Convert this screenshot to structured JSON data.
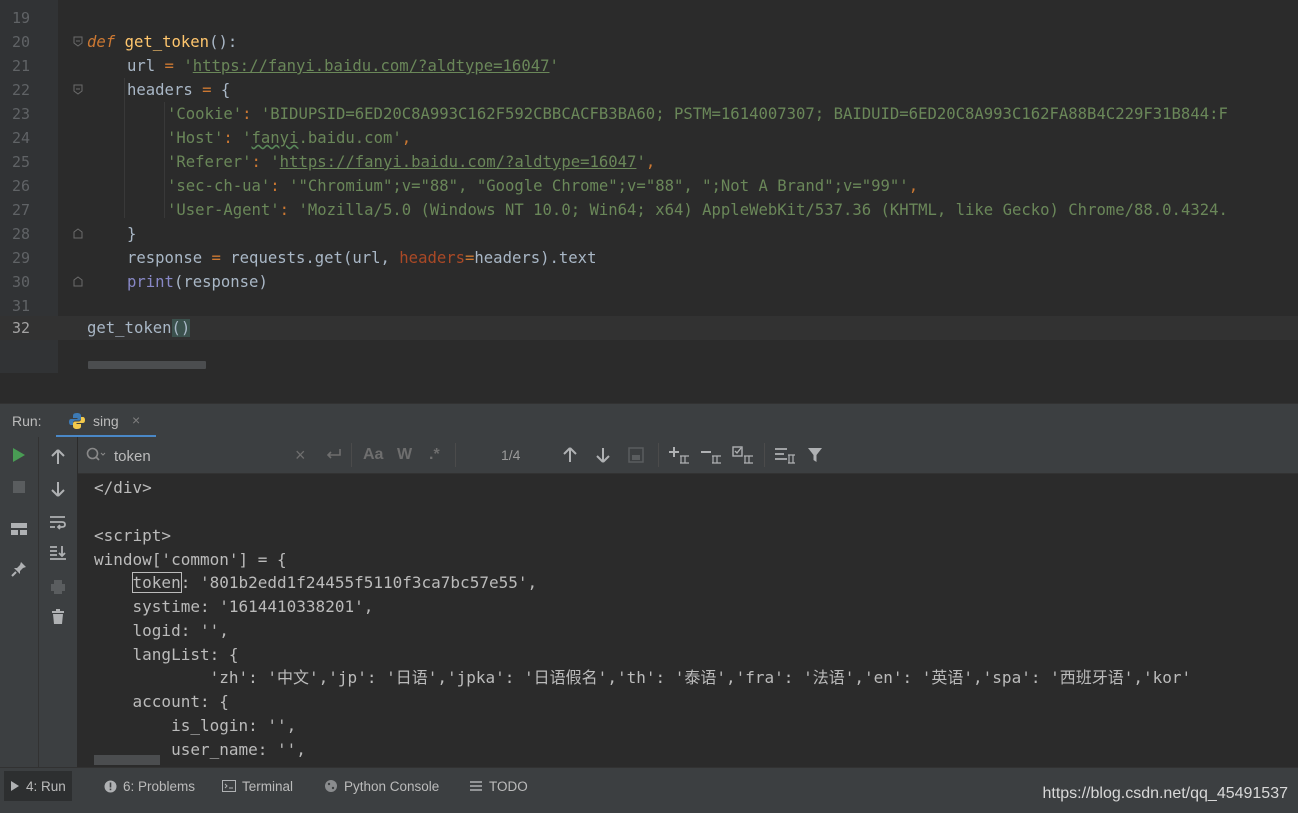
{
  "editor": {
    "lines": [
      {
        "num": "19"
      },
      {
        "num": "20",
        "def_kw": "def",
        "fn_name": "get_token",
        "paren": "():"
      },
      {
        "num": "21",
        "var": "url",
        "eq": " = ",
        "q1": "'",
        "url": "https://fanyi.baidu.com/?aldtype=16047",
        "q2": "'"
      },
      {
        "num": "22",
        "var": "headers",
        "eq": " = ",
        "brace": "{"
      },
      {
        "num": "23",
        "key": "'Cookie'",
        "colon": ": ",
        "val": "'BIDUPSID=6ED20C8A993C162F592CBBCACFB3BA60; PSTM=1614007307; BAIDUID=6ED20C8A993C162FA88B4C229F31B844:F"
      },
      {
        "num": "24",
        "key": "'Host'",
        "colon": ": ",
        "q1": "'",
        "val": "fanyi",
        "val2": ".baidu.com'",
        "comma": ","
      },
      {
        "num": "25",
        "key": "'Referer'",
        "colon": ": ",
        "q1": "'",
        "url": "https://fanyi.baidu.com/?aldtype=16047",
        "q2": "'",
        "comma": ","
      },
      {
        "num": "26",
        "key": "'sec-ch-ua'",
        "colon": ": ",
        "val": "'\"Chromium\";v=\"88\", \"Google Chrome\";v=\"88\", \";Not A Brand\";v=\"99\"'",
        "comma": ","
      },
      {
        "num": "27",
        "key": "'User-Agent'",
        "colon": ": ",
        "val": "'Mozilla/5.0 (Windows NT 10.0; Win64; x64) AppleWebKit/537.36 (KHTML, like Gecko) Chrome/88.0.4324."
      },
      {
        "num": "28",
        "brace": "}"
      },
      {
        "num": "29",
        "a": "response",
        "eq": " = ",
        "b": "requests.",
        "c": "get",
        "d": "(url, ",
        "p": "headers",
        "e": "=",
        "f": "headers).text"
      },
      {
        "num": "30",
        "builtin": "print",
        "rest": "(response)"
      },
      {
        "num": "31"
      },
      {
        "num": "32",
        "call": "get_token",
        "paren": "()"
      }
    ]
  },
  "run": {
    "label": "Run:",
    "tab_name": "sing",
    "tab_close": "×"
  },
  "search": {
    "value": "token",
    "clear": "×",
    "match_case": "Aa",
    "words": "W",
    "regex": ".*",
    "count": "1/4"
  },
  "console": {
    "lines": [
      "</div>",
      "",
      "<script>",
      "window['common'] = {",
      "    token: '801b2edd1f24455f5110f3ca7bc57e55',",
      "    systime: '1614410338201',",
      "    logid: '',",
      "    langList: {",
      "            'zh': '中文','jp': '日语','jpka': '日语假名','th': '泰语','fra': '法语','en': '英语','spa': '西班牙语','kor'",
      "    account: {",
      "        is_login: '',",
      "        user_name: '',"
    ],
    "token_word": "token",
    "token_rest": ": '801b2edd1f24455f5110f3ca7bc57e55',",
    "indent": "    "
  },
  "bottom": {
    "run": "4: Run",
    "problems": "6: Problems",
    "terminal": "Terminal",
    "python_console": "Python Console",
    "todo": "TODO",
    "watermark": "https://blog.csdn.net/qq_45491537"
  },
  "icons": [
    "run-icon",
    "stop-icon",
    "layout-icon",
    "pin-icon",
    "arrow-up-icon",
    "arrow-down-icon",
    "soft-wrap-icon",
    "scroll-to-end-icon",
    "print-icon",
    "trash-icon",
    "search-icon",
    "python-icon",
    "filter-icon"
  ]
}
